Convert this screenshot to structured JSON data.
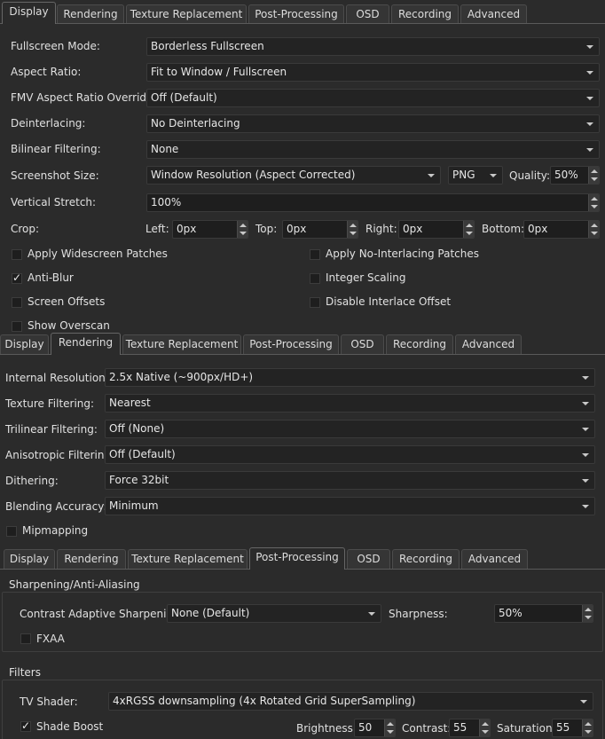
{
  "tabs": [
    "Display",
    "Rendering",
    "Texture Replacement",
    "Post-Processing",
    "OSD",
    "Recording",
    "Advanced"
  ],
  "display": {
    "active_tab": "Display",
    "fullscreen_label": "Fullscreen Mode:",
    "fullscreen_value": "Borderless Fullscreen",
    "aspect_label": "Aspect Ratio:",
    "aspect_value": "Fit to Window / Fullscreen",
    "fmv_label": "FMV Aspect Ratio Override:",
    "fmv_value": "Off (Default)",
    "deinterlacing_label": "Deinterlacing:",
    "deinterlacing_value": "No Deinterlacing",
    "bilinear_label": "Bilinear Filtering:",
    "bilinear_value": "None",
    "screenshot_label": "Screenshot Size:",
    "screenshot_value": "Window Resolution (Aspect Corrected)",
    "screenshot_format": "PNG",
    "quality_label": "Quality:",
    "quality_value": "50%",
    "vstretch_label": "Vertical Stretch:",
    "vstretch_value": "100%",
    "crop_label": "Crop:",
    "crop_left_label": "Left:",
    "crop_left_value": "0px",
    "crop_top_label": "Top:",
    "crop_top_value": "0px",
    "crop_right_label": "Right:",
    "crop_right_value": "0px",
    "crop_bottom_label": "Bottom:",
    "crop_bottom_value": "0px",
    "widescreen_label": "Apply Widescreen Patches",
    "nointerlace_label": "Apply No-Interlacing Patches",
    "antiblur_label": "Anti-Blur",
    "integer_label": "Integer Scaling",
    "offsets_label": "Screen Offsets",
    "disable_offset_label": "Disable Interlace Offset",
    "overscan_label": "Show Overscan",
    "check_mark": "✓"
  },
  "rendering": {
    "active_tab": "Rendering",
    "internal_label": "Internal Resolution:",
    "internal_value": "2.5x Native (~900px/HD+)",
    "texture_label": "Texture Filtering:",
    "texture_value": "Nearest",
    "trilinear_label": "Trilinear Filtering:",
    "trilinear_value": "Off (None)",
    "aniso_label": "Anisotropic Filtering:",
    "aniso_value": "Off (Default)",
    "dithering_label": "Dithering:",
    "dithering_value": "Force 32bit",
    "blending_label": "Blending Accuracy:",
    "blending_value": "Minimum",
    "mipmapping_label": "Mipmapping"
  },
  "postprocessing": {
    "active_tab": "Post-Processing",
    "sharpening_group": "Sharpening/Anti-Aliasing",
    "cas_label": "Contrast Adaptive Sharpening:",
    "cas_value": "None (Default)",
    "sharpness_label": "Sharpness:",
    "sharpness_value": "50%",
    "fxaa_label": "FXAA",
    "filters_group": "Filters",
    "tvshader_label": "TV Shader:",
    "tvshader_value": "4xRGSS downsampling (4x Rotated Grid SuperSampling)",
    "shadeboost_label": "Shade Boost",
    "brightness_label": "Brightness:",
    "brightness_value": "50",
    "contrast_label": "Contrast:",
    "contrast_value": "55",
    "saturation_label": "Saturation:",
    "saturation_value": "55",
    "check_mark": "✓"
  }
}
